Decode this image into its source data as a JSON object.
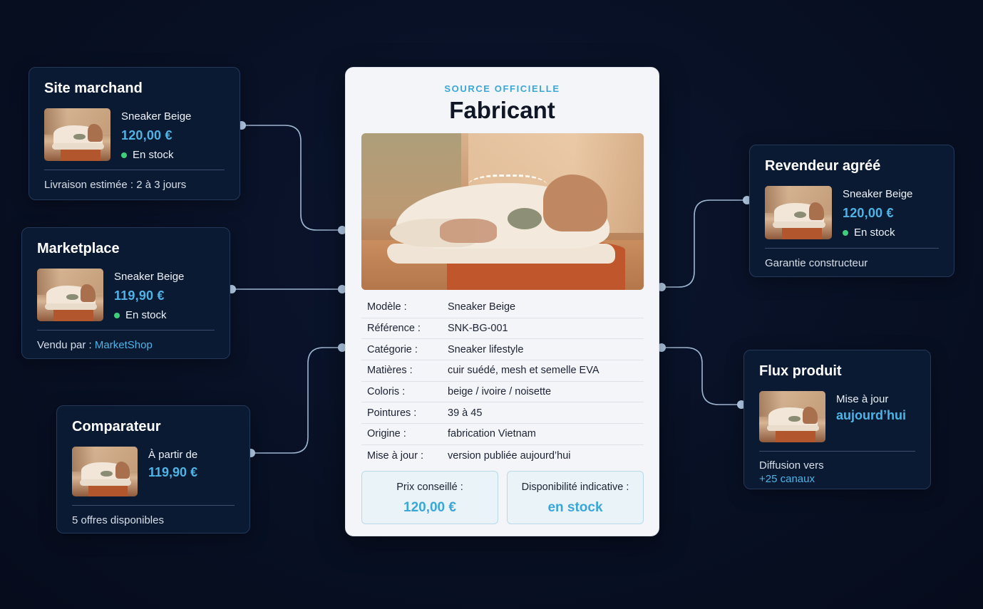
{
  "center": {
    "source_label": "SOURCE OFFICIELLE",
    "title": "Fabricant",
    "specs": [
      {
        "key": "Modèle :",
        "value": "Sneaker Beige"
      },
      {
        "key": "Référence :",
        "value": "SNK-BG-001"
      },
      {
        "key": "Catégorie :",
        "value": "Sneaker lifestyle"
      },
      {
        "key": "Matières :",
        "value": "cuir suédé, mesh et semelle EVA"
      },
      {
        "key": "Coloris :",
        "value": "beige / ivoire / noisette"
      },
      {
        "key": "Pointures :",
        "value": "39 à 45"
      },
      {
        "key": "Origine :",
        "value": "fabrication Vietnam"
      },
      {
        "key": "Mise à jour :",
        "value": "version publiée aujourd’hui"
      }
    ],
    "price_label": "Prix conseillé :",
    "price_value": "120,00 €",
    "availability_label": "Disponibilité indicative :",
    "availability_value": "en stock"
  },
  "site_marchand": {
    "title": "Site marchand",
    "product": "Sneaker Beige",
    "price": "120,00 €",
    "stock": "En stock",
    "footer": "Livraison estimée : 2 à 3 jours"
  },
  "marketplace": {
    "title": "Marketplace",
    "product": "Sneaker Beige",
    "price": "119,90 €",
    "stock": "En stock",
    "footer_prefix": "Vendu par : ",
    "seller": "MarketShop"
  },
  "comparateur": {
    "title": "Comparateur",
    "from_label": "À partir de",
    "price": "119,90 €",
    "footer": "5 offres disponibles"
  },
  "revendeur": {
    "title": "Revendeur agréé",
    "product": "Sneaker Beige",
    "price": "120,00 €",
    "stock": "En stock",
    "footer": "Garantie constructeur"
  },
  "flux": {
    "title": "Flux produit",
    "update_label": "Mise à jour",
    "update_value": "aujourd’hui",
    "footer_label": "Diffusion vers",
    "footer_value": "+25 canaux"
  },
  "colors": {
    "background": "#081024",
    "card": "#0b1a33",
    "accent": "#4fb3e6",
    "stock_dot": "#3fcf7a",
    "connector": "#b9d3ee"
  }
}
